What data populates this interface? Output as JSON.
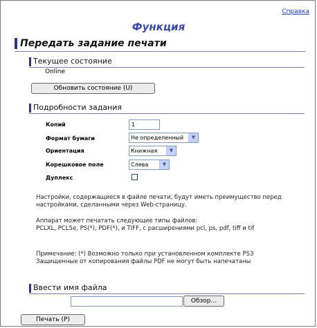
{
  "header": {
    "help_link": "Справка",
    "function_title": "Функция",
    "page_title": "Передать задание печати"
  },
  "status_section": {
    "title": "Текущее состояние",
    "value": "Online",
    "refresh_button": "Обновить состояние (U)"
  },
  "details_section": {
    "title": "Подробности задания",
    "copies": {
      "label": "Копий",
      "value": "1"
    },
    "paper_size": {
      "label": "Формат бумаги",
      "value": "Не определенный"
    },
    "orientation": {
      "label": "Ориентация",
      "value": "Книжная"
    },
    "binding_edge": {
      "label": "Корешковое поле",
      "value": "Слева"
    },
    "duplex": {
      "label": "Дуплекс",
      "checked": false
    },
    "note1": "Настройки, содержащиеся в файле печати, будут иметь преимущество перед настройками, сделанными через Web-страницу.",
    "note2_line1": "Аппарат может печатать следующие типы файлов:",
    "note2_line2": "PCLXL, PCL5e, PS(*), PDF(*), и TIFF, с расширениями pcl, ps, pdf, tiff и tif",
    "note3_line1": "Примечание: (*) Возможно только при установленном комплекте PS3",
    "note3_line2": "Защищенные от копирования файлы PDF не могут быть напечатаны"
  },
  "file_section": {
    "title": "Ввести имя файла",
    "file_value": "",
    "browse_button": "Обзор..."
  },
  "print_button": "Печать (P)"
}
